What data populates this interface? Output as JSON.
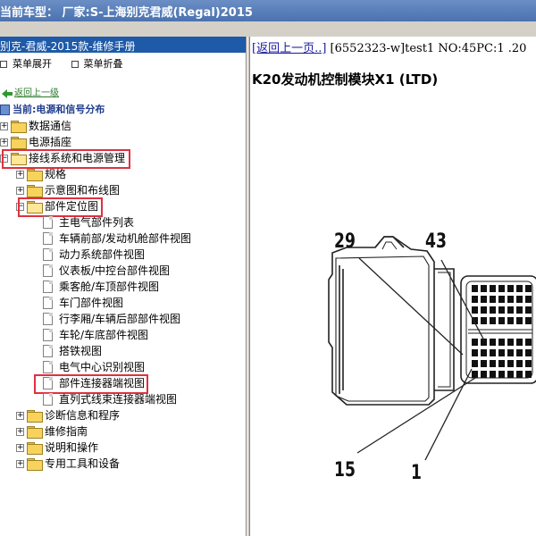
{
  "window": {
    "title": "当前车型：   厂家:S-上海别克君威(Regal)2015"
  },
  "left_panel": {
    "header": "别克-君威-2015款-维修手册",
    "toolbar": {
      "expand_label": "菜单展开",
      "collapse_label": "菜单折叠"
    },
    "back_label": "返回上一级",
    "current_label": "当前:电源和信号分布",
    "tree": [
      {
        "label": "数据通信",
        "level": 0,
        "type": "folder",
        "expanded": false
      },
      {
        "label": "电源插座",
        "level": 0,
        "type": "folder",
        "expanded": false
      },
      {
        "label": "接线系统和电源管理",
        "level": 0,
        "type": "folder",
        "expanded": true,
        "highlighted": true
      },
      {
        "label": "规格",
        "level": 1,
        "type": "folder",
        "expanded": false
      },
      {
        "label": "示意图和布线图",
        "level": 1,
        "type": "folder",
        "expanded": false
      },
      {
        "label": "部件定位图",
        "level": 1,
        "type": "folder",
        "expanded": true,
        "highlighted": true
      },
      {
        "label": "主电气部件列表",
        "level": 2,
        "type": "doc"
      },
      {
        "label": "车辆前部/发动机舱部件视图",
        "level": 2,
        "type": "doc"
      },
      {
        "label": "动力系统部件视图",
        "level": 2,
        "type": "doc"
      },
      {
        "label": "仪表板/中控台部件视图",
        "level": 2,
        "type": "doc"
      },
      {
        "label": "乘客舱/车顶部件视图",
        "level": 2,
        "type": "doc"
      },
      {
        "label": "车门部件视图",
        "level": 2,
        "type": "doc"
      },
      {
        "label": "行李厢/车辆后部部件视图",
        "level": 2,
        "type": "doc"
      },
      {
        "label": "车轮/车底部件视图",
        "level": 2,
        "type": "doc"
      },
      {
        "label": "搭铁视图",
        "level": 2,
        "type": "doc"
      },
      {
        "label": "电气中心识别视图",
        "level": 2,
        "type": "doc"
      },
      {
        "label": "部件连接器端视图",
        "level": 2,
        "type": "doc",
        "highlighted": true
      },
      {
        "label": "直列式线束连接器端视图",
        "level": 2,
        "type": "doc"
      },
      {
        "label": "诊断信息和程序",
        "level": 1,
        "type": "folder",
        "expanded": false
      },
      {
        "label": "维修指南",
        "level": 1,
        "type": "folder",
        "expanded": false
      },
      {
        "label": "说明和操作",
        "level": 1,
        "type": "folder",
        "expanded": false
      },
      {
        "label": "专用工具和设备",
        "level": 1,
        "type": "folder",
        "expanded": false
      }
    ]
  },
  "right_panel": {
    "back_link": "[返回上一页..]",
    "meta": " [6552323-w]test1 NO:45PC:1 .20",
    "doc_title": "K20发动机控制模块X1 (LTD)",
    "diagram_labels": {
      "tl": "29",
      "tr": "43",
      "bl": "15",
      "br": "1"
    }
  },
  "colors": {
    "highlight": "#e03040",
    "header_bg": "#1e5aa8",
    "link": "#1a1aa0"
  }
}
